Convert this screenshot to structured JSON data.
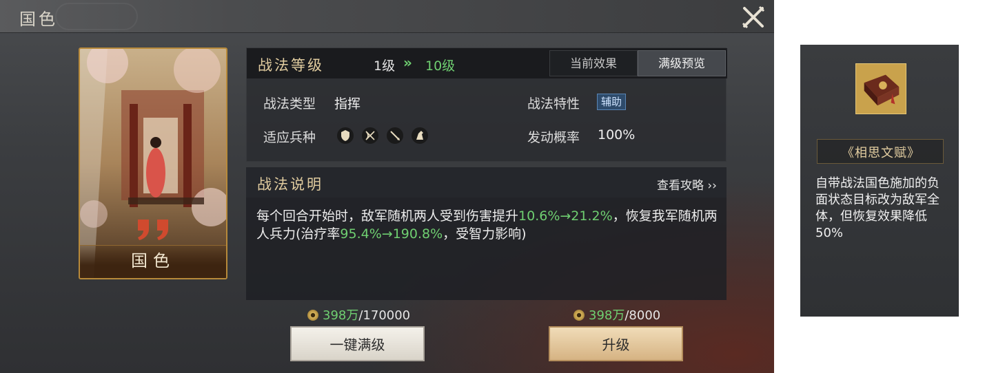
{
  "header": {
    "title": "国色"
  },
  "card": {
    "name": "国色"
  },
  "level": {
    "title": "战法等级",
    "from": "1级",
    "arrow": "»",
    "to": "10级",
    "tabs": [
      {
        "label": "当前效果",
        "selected": false
      },
      {
        "label": "满级预览",
        "selected": true
      }
    ]
  },
  "attributes": {
    "type_label": "战法类型",
    "type_value": "指挥",
    "trait_label": "战法特性",
    "trait_value": "辅助",
    "troops_label": "适应兵种",
    "troop_icons": [
      "shield-icon",
      "bow-icon",
      "spear-icon",
      "horse-icon"
    ],
    "rate_label": "发动概率",
    "rate_value": "100%"
  },
  "description": {
    "title": "战法说明",
    "guide_link": "查看攻略 ››",
    "seg1": "每个回合开始时，敌军随机两人受到伤害提升",
    "hl1": "10.6%→21.2%",
    "seg2": "，恢复我军随机两人兵力(治疗率",
    "hl2": "95.4%→190.8%",
    "seg3": "，受智力影响)"
  },
  "costs": [
    {
      "have": "398万",
      "need": "/170000"
    },
    {
      "have": "398万",
      "need": "/8000"
    }
  ],
  "buttons": {
    "max_level": "一键满级",
    "upgrade": "升级"
  },
  "book": {
    "title": "《相思文赋》",
    "description": "自带战法国色施加的负面状态目标改为敌军全体，但恢复效果降低50%"
  },
  "colors": {
    "highlight_green": "#6fcf71",
    "title_gold": "#e2cda0",
    "support_tag_blue": "#2e4b6b"
  }
}
